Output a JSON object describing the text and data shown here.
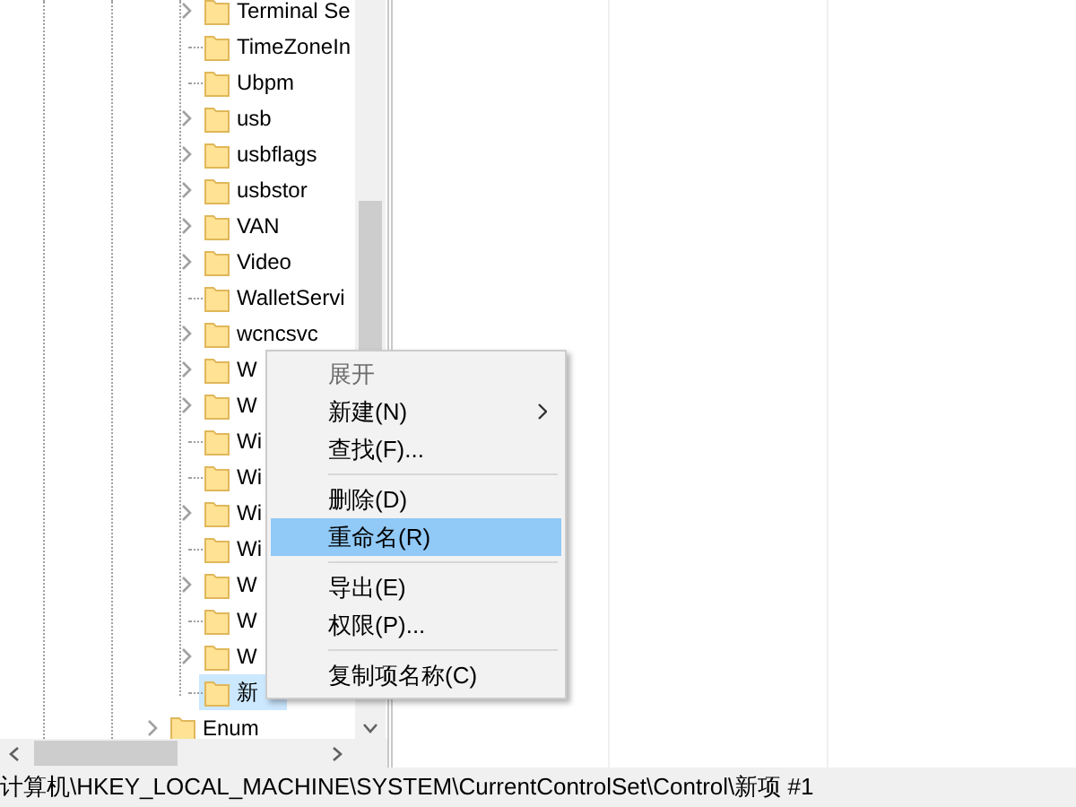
{
  "tree": [
    {
      "children": [
        {
          "label": "Terminal Se",
          "expandable": true,
          "selected": false
        },
        {
          "label": "TimeZoneIn",
          "expandable": false,
          "selected": false
        },
        {
          "label": "Ubpm",
          "expandable": false,
          "selected": false
        },
        {
          "label": "usb",
          "expandable": true,
          "selected": false
        },
        {
          "label": "usbflags",
          "expandable": true,
          "selected": false
        },
        {
          "label": "usbstor",
          "expandable": true,
          "selected": false
        },
        {
          "label": "VAN",
          "expandable": true,
          "selected": false
        },
        {
          "label": "Video",
          "expandable": true,
          "selected": false
        },
        {
          "label": "WalletServi",
          "expandable": false,
          "selected": false
        },
        {
          "label": "wcncsvc",
          "expandable": true,
          "selected": false
        },
        {
          "label": "W",
          "expandable": true,
          "selected": false
        },
        {
          "label": "W",
          "expandable": true,
          "selected": false
        },
        {
          "label": "Wi",
          "expandable": false,
          "selected": false
        },
        {
          "label": "Wi",
          "expandable": false,
          "selected": false
        },
        {
          "label": "Wi",
          "expandable": true,
          "selected": false
        },
        {
          "label": "Wi",
          "expandable": false,
          "selected": false
        },
        {
          "label": "W",
          "expandable": true,
          "selected": false
        },
        {
          "label": "W",
          "expandable": false,
          "selected": false
        },
        {
          "label": "W",
          "expandable": true,
          "selected": false
        },
        {
          "label": "新",
          "expandable": false,
          "selected": true
        }
      ]
    },
    {
      "label": "Enum",
      "expandable": true,
      "selected": false
    }
  ],
  "context_menu": [
    {
      "kind": "item",
      "label": "展开",
      "disabled": true,
      "submenu": false,
      "selected": false
    },
    {
      "kind": "item",
      "label": "新建(N)",
      "disabled": false,
      "submenu": true,
      "selected": false
    },
    {
      "kind": "item",
      "label": "查找(F)...",
      "disabled": false,
      "submenu": false,
      "selected": false
    },
    {
      "kind": "separator"
    },
    {
      "kind": "item",
      "label": "删除(D)",
      "disabled": false,
      "submenu": false,
      "selected": false
    },
    {
      "kind": "item",
      "label": "重命名(R)",
      "disabled": false,
      "submenu": false,
      "selected": true
    },
    {
      "kind": "separator"
    },
    {
      "kind": "item",
      "label": "导出(E)",
      "disabled": false,
      "submenu": false,
      "selected": false
    },
    {
      "kind": "item",
      "label": "权限(P)...",
      "disabled": false,
      "submenu": false,
      "selected": false
    },
    {
      "kind": "separator"
    },
    {
      "kind": "item",
      "label": "复制项名称(C)",
      "disabled": false,
      "submenu": false,
      "selected": false
    }
  ],
  "status_bar": "计算机\\HKEY_LOCAL_MACHINE\\SYSTEM\\CurrentControlSet\\Control\\新项 #1"
}
